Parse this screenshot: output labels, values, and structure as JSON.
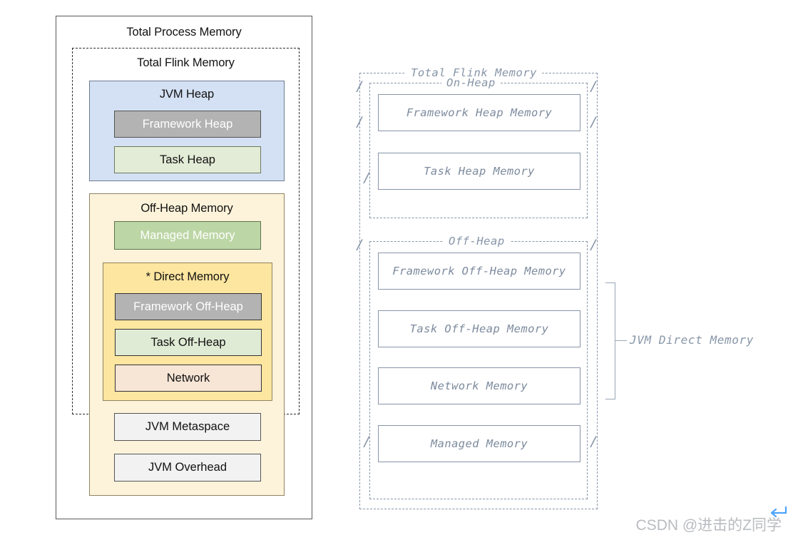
{
  "left_diagram": {
    "outer_label": "Total Process Memory",
    "flink_label": "Total Flink Memory",
    "jvm_heap": {
      "label": "JVM Heap",
      "children": [
        {
          "label": "Framework Heap",
          "fill": "#b3b3b3",
          "text_color": "#ffffff"
        },
        {
          "label": "Task Heap",
          "fill": "#e3ecd6",
          "text_color": "#111111"
        }
      ]
    },
    "off_heap": {
      "label": "Off-Heap Memory",
      "managed": {
        "label": "Managed Memory",
        "fill": "#bcd6a5",
        "text_color": "#ffffff"
      },
      "direct": {
        "label": "* Direct Memory",
        "children": [
          {
            "label": "Framework Off-Heap",
            "fill": "#b3b3b3",
            "text_color": "#ffffff"
          },
          {
            "label": "Task Off-Heap",
            "fill": "#e0ebd5",
            "text_color": "#111111"
          },
          {
            "label": "Network",
            "fill": "#f7e5d6",
            "text_color": "#111111"
          }
        ]
      },
      "metaspace": "JVM Metaspace",
      "overhead": "JVM Overhead"
    },
    "colors": {
      "jvm_heap_fill": "#d4e1f4",
      "off_heap_fill": "#fcf3da",
      "direct_memory_fill": "#fde6a0",
      "plain_box_fill": "#f2f2f2",
      "outline": "#555a5e"
    }
  },
  "right_diagram": {
    "outer_title_prefix": "Total ",
    "outer_title_misspelled": "Flink",
    "outer_title_suffix": " Memory",
    "on_heap_title": "On-Heap",
    "off_heap_title": "Off-Heap",
    "boxes": {
      "framework_heap": "Framework Heap Memory",
      "task_heap": "Task Heap Memory",
      "framework_off_heap": "Framework Off-Heap Memory",
      "task_off_heap": "Task Off-Heap Memory",
      "network": "Network Memory",
      "managed": "Managed Memory"
    },
    "bracket_label": "JVM Direct Memory",
    "slashes": {
      "mark": "/",
      "bar": "|"
    },
    "colors": {
      "line": "#8795a8",
      "text": "#7d8b9e",
      "spellcheck_underline": "#8bbf7a"
    }
  },
  "watermark": {
    "text": "CSDN @进击的Z同学",
    "color": "#b9bcc0",
    "arrow_color": "#4da3ff"
  }
}
